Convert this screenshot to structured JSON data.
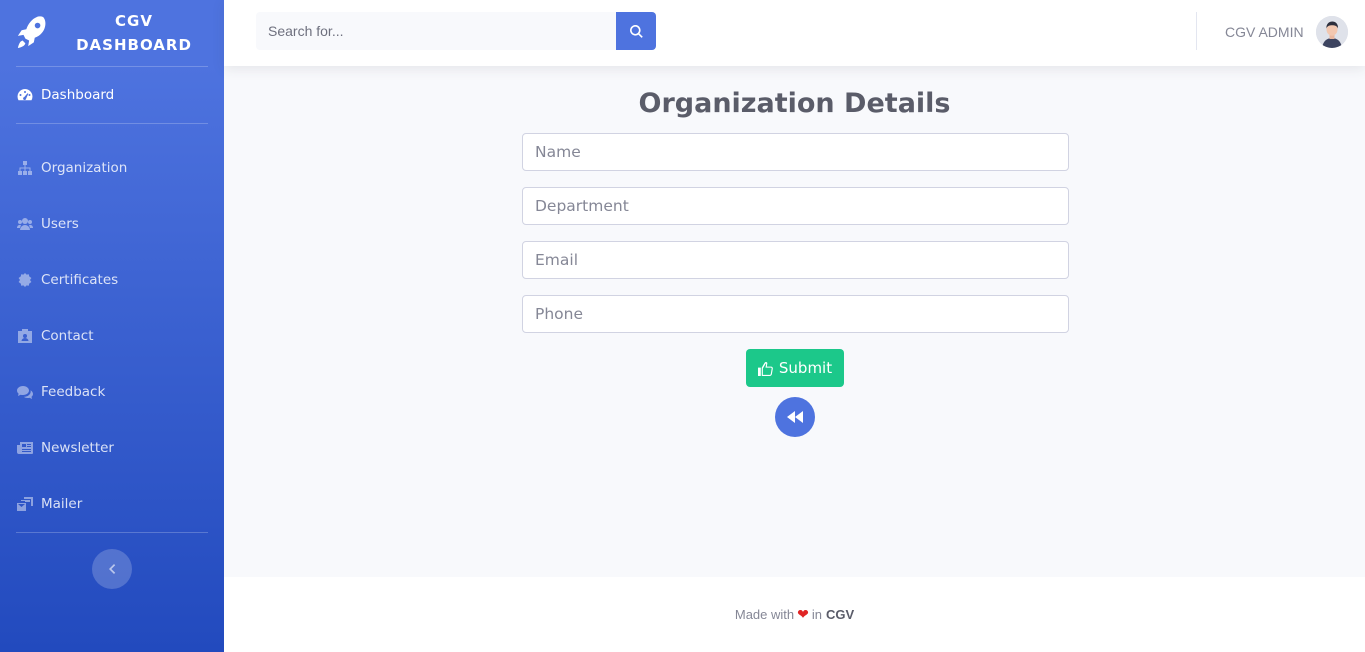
{
  "brand": {
    "line1": "CGV",
    "line2": "DASHBOARD"
  },
  "sidebar": {
    "active": {
      "label": "Dashboard",
      "icon": "tachometer-icon"
    },
    "items": [
      {
        "label": "Organization",
        "icon": "sitemap-icon"
      },
      {
        "label": "Users",
        "icon": "users-icon"
      },
      {
        "label": "Certificates",
        "icon": "certificate-icon"
      },
      {
        "label": "Contact",
        "icon": "contact-card-icon"
      },
      {
        "label": "Feedback",
        "icon": "comments-icon"
      },
      {
        "label": "Newsletter",
        "icon": "newspaper-icon"
      },
      {
        "label": "Mailer",
        "icon": "mail-bulk-icon"
      }
    ]
  },
  "topbar": {
    "search_placeholder": "Search for...",
    "user_name": "CGV ADMIN"
  },
  "main": {
    "title": "Organization Details",
    "fields": [
      {
        "placeholder": "Name",
        "value": ""
      },
      {
        "placeholder": "Department",
        "value": ""
      },
      {
        "placeholder": "Email",
        "value": ""
      },
      {
        "placeholder": "Phone",
        "value": ""
      }
    ],
    "submit_label": "Submit"
  },
  "footer": {
    "prefix": "Made with",
    "middle": "in",
    "brand": "CGV"
  },
  "colors": {
    "primary": "#4e73df",
    "success": "#1cc88a",
    "heart": "#e02424"
  }
}
